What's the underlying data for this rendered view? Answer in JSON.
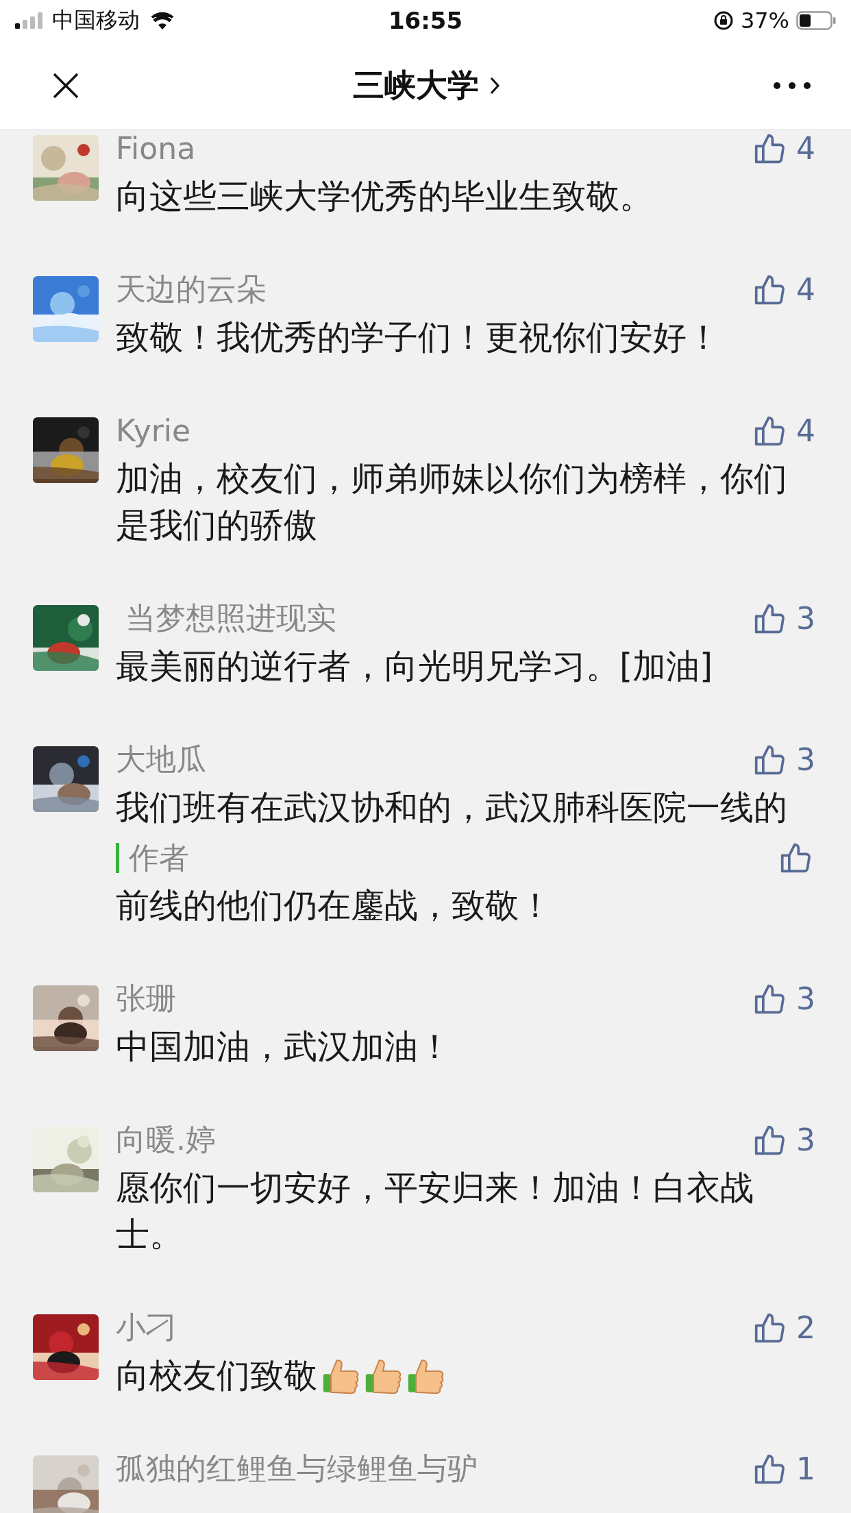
{
  "status_bar": {
    "carrier": "中国移动",
    "time": "16:55",
    "battery": "37%"
  },
  "nav": {
    "title": "三峡大学"
  },
  "comments": [
    {
      "name": "Fiona",
      "likes": "4",
      "text": "向这些三峡大学优秀的毕业生致敬。"
    },
    {
      "name": "天边的云朵",
      "likes": "4",
      "text": "致敬！我优秀的学子们！更祝你们安好！"
    },
    {
      "name": "Kyrie",
      "likes": "4",
      "text": "加油，校友们，师弟师妹以你们为榜样，你们是我们的骄傲"
    },
    {
      "name": " 当梦想照进现实",
      "likes": "3",
      "text": "最美丽的逆行者，向光明兄学习。[加油]"
    },
    {
      "name": "大地瓜",
      "likes": "3",
      "text": "我们班有在武汉协和的，武汉肺科医院一线的",
      "reply": {
        "author": "作者",
        "text": "前线的他们仍在鏖战，致敬！"
      }
    },
    {
      "name": "张珊",
      "likes": "3",
      "text": "中国加油，武汉加油！"
    },
    {
      "name": "向暖.婷",
      "likes": "3",
      "text": "愿你们一切安好，平安归来！加油！白衣战士。"
    },
    {
      "name": "小刁",
      "likes": "2",
      "text": "向校友们致敬",
      "stickers": [
        {
          "kind": "thumbs-up"
        },
        {
          "kind": "thumbs-up"
        },
        {
          "kind": "thumbs-up"
        }
      ]
    },
    {
      "name": "孤独的红鲤鱼与绿鲤鱼与驴",
      "likes": "1"
    }
  ]
}
